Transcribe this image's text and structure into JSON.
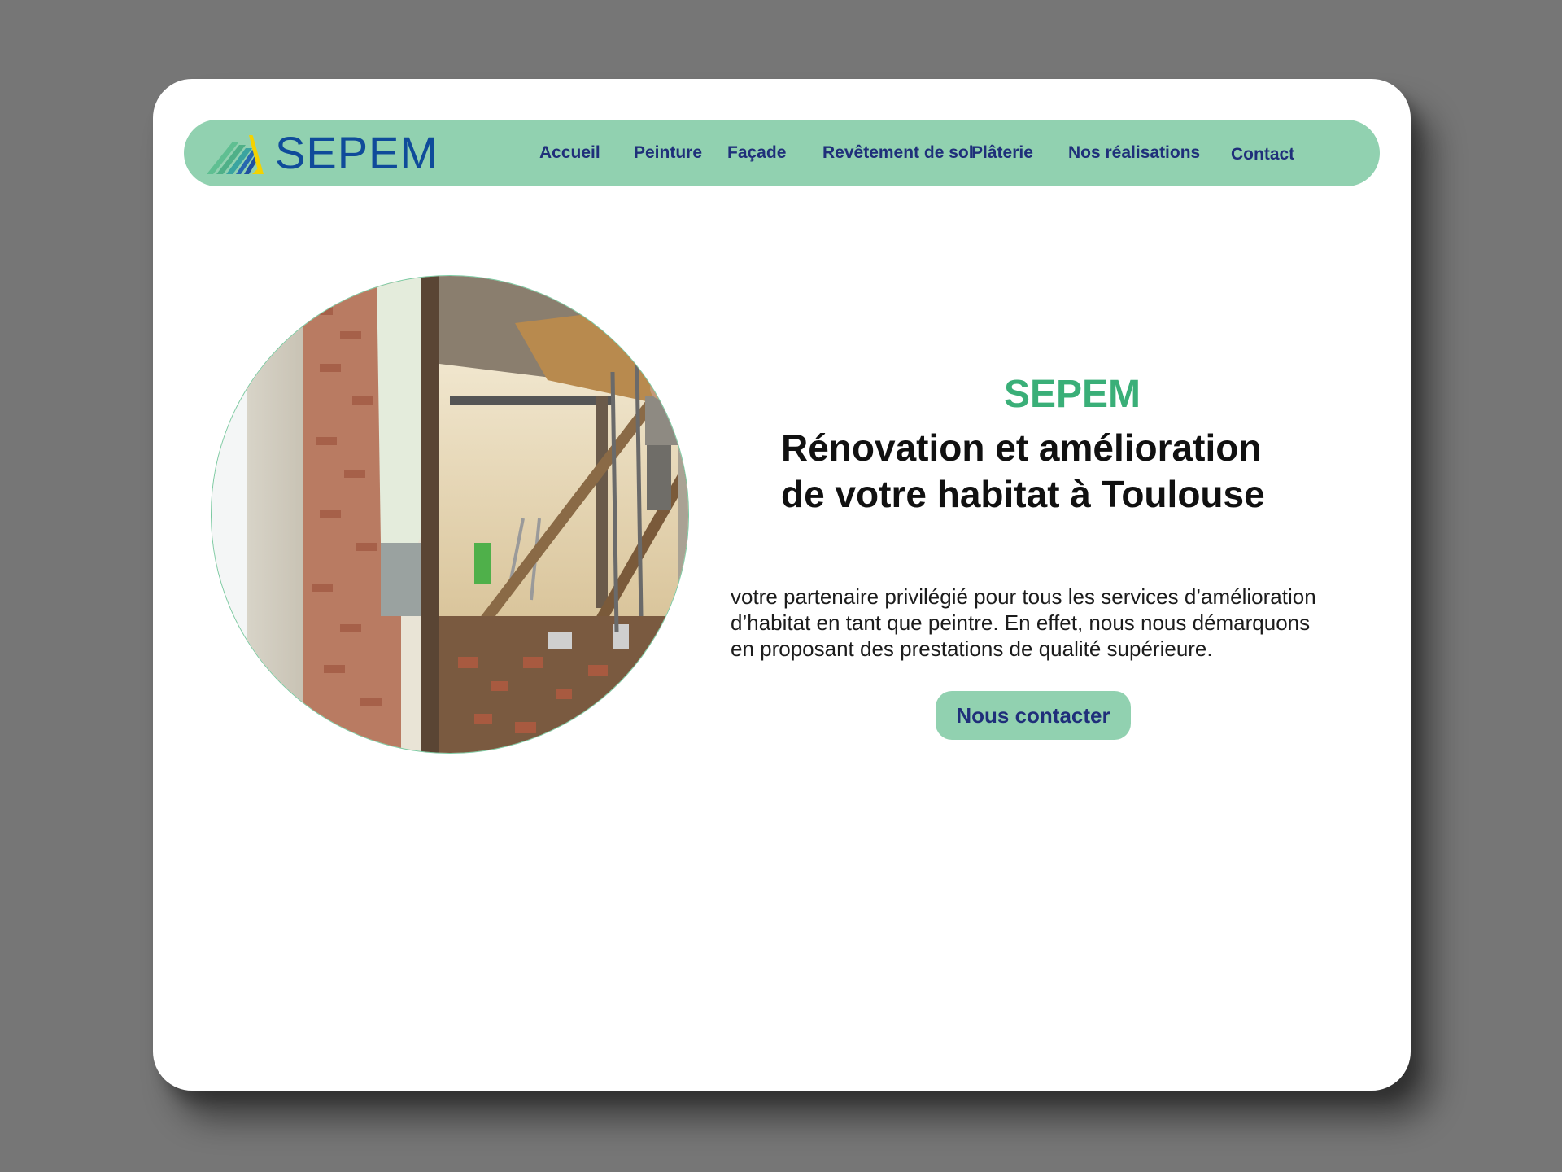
{
  "brand": {
    "name": "SEPEM",
    "color": "#0f4b9a",
    "accent": "#3aaf78",
    "nav_bg": "#91d1b0"
  },
  "nav": {
    "items": [
      {
        "label": "Accueil"
      },
      {
        "label": "Peinture"
      },
      {
        "label": "Façade"
      },
      {
        "label": "Revêtement de sol"
      },
      {
        "label": "Plâterie"
      },
      {
        "label": "Nos réalisations"
      },
      {
        "label": "Contact"
      }
    ]
  },
  "hero": {
    "brand_title": "SEPEM",
    "title_line1": "Rénovation et amélioration",
    "title_line2": "de votre habitat à Toulouse",
    "text_line1": "votre partenaire privilégié pour tous les services d’amélioration",
    "text_line2": "d’habitat en tant que peintre. En effet, nous nous démarquons",
    "text_line3": "en proposant des prestations de qualité supérieure.",
    "cta_label": "Nous contacter",
    "image_icon": "renovation-photo"
  }
}
